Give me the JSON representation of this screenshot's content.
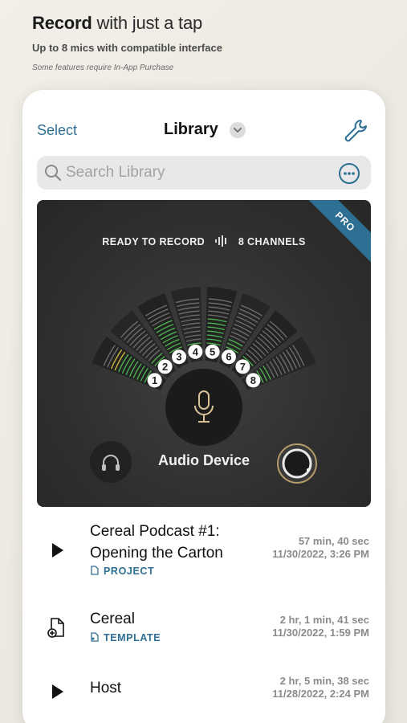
{
  "promo": {
    "title_bold": "Record",
    "title_rest": "with just a tap",
    "subtitle": "Up to 8 mics with compatible interface",
    "note": "Some features require In-App Purchase"
  },
  "nav": {
    "select_label": "Select",
    "title": "Library"
  },
  "search": {
    "placeholder": "Search Library",
    "value": ""
  },
  "device": {
    "badge": "PRO",
    "status_left": "READY TO RECORD",
    "status_right": "8 CHANNELS",
    "name": "Audio Device",
    "channels": [
      "1",
      "2",
      "3",
      "4",
      "5",
      "6",
      "7",
      "8"
    ],
    "levels": [
      0.85,
      0.2,
      0.7,
      0.1,
      0.6,
      0.3,
      0.15,
      0.25
    ],
    "colors": {
      "accent": "#2e6f94",
      "meter_green": "#4caf50",
      "meter_yellow": "#c9b23a",
      "meter_red": "#c0392b"
    }
  },
  "recordings": [
    {
      "title_line1": "Cereal Podcast #1:",
      "title_line2": "Opening the Carton",
      "tag": "PROJECT",
      "duration": "57 min, 40 sec",
      "date": "11/30/2022, 3:26 PM",
      "icon": "play-icon"
    },
    {
      "title_line1": "Cereal",
      "tag": "TEMPLATE",
      "duration": "2 hr, 1 min, 41 sec",
      "date": "11/30/2022, 1:59 PM",
      "icon": "new-document-icon"
    },
    {
      "title_line1": "Host",
      "duration": "2 hr, 5 min, 38 sec",
      "date": "11/28/2022, 2:24 PM",
      "icon": "play-icon"
    }
  ]
}
